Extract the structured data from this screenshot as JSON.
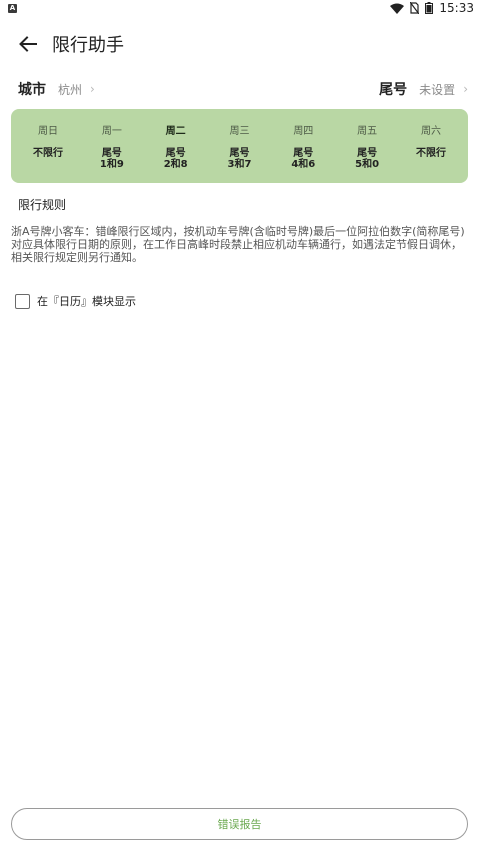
{
  "status_bar": {
    "notification_icon": "notification-a-icon",
    "time": "15:33"
  },
  "app_bar": {
    "title": "限行助手",
    "back_icon": "arrow-left-icon"
  },
  "city": {
    "label": "城市",
    "value": "杭州"
  },
  "plate_tail": {
    "label": "尾号",
    "value": "未设置"
  },
  "week": [
    {
      "day": "周日",
      "rule_line1": "不限行",
      "rule_line2": ""
    },
    {
      "day": "周一",
      "rule_line1": "尾号",
      "rule_line2": "1和9"
    },
    {
      "day": "周二",
      "rule_line1": "尾号",
      "rule_line2": "2和8"
    },
    {
      "day": "周三",
      "rule_line1": "尾号",
      "rule_line2": "3和7"
    },
    {
      "day": "周四",
      "rule_line1": "尾号",
      "rule_line2": "4和6"
    },
    {
      "day": "周五",
      "rule_line1": "尾号",
      "rule_line2": "5和0"
    },
    {
      "day": "周六",
      "rule_line1": "不限行",
      "rule_line2": ""
    }
  ],
  "colors": {
    "card_bg": "#b9d7a4",
    "accent_green": "#6aa84f"
  },
  "rules": {
    "title": "限行规则",
    "text": "浙A号牌小客车：错峰限行区域内，按机动车号牌(含临时号牌)最后一位阿拉伯数字(简称尾号)对应具体限行日期的原则，在工作日高峰时段禁止相应机动车辆通行，如遇法定节假日调休，相关限行规定则另行通知。"
  },
  "calendar_option": {
    "label": "在『日历』模块显示",
    "checked": false
  },
  "report_button": {
    "label": "错误报告"
  }
}
